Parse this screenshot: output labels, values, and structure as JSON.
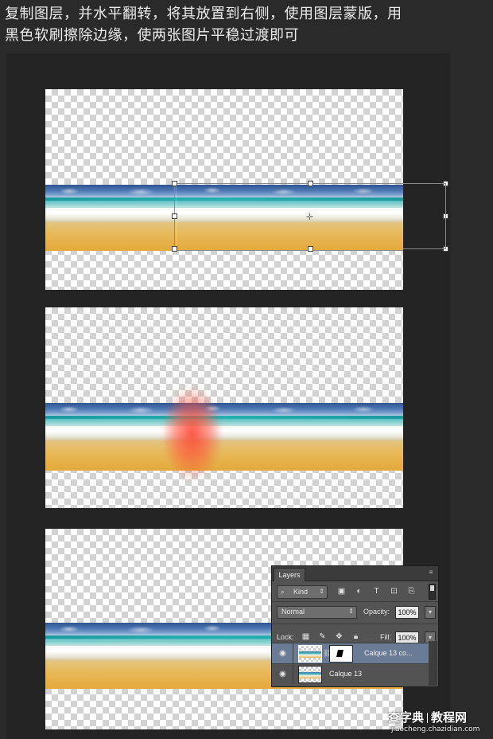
{
  "caption": {
    "line1": "复制图层，并水平翻转，将其放置到右侧，使用图层蒙版，用",
    "line2": "黑色软刷擦除边缘，使两张图片平稳过渡即可"
  },
  "layers_panel": {
    "tab_label": "Layers",
    "menu_icon": "panel-menu-icon",
    "filter": {
      "label": "Kind",
      "icon": "search-icon"
    },
    "filter_icons": [
      "image-filter-icon",
      "adjustment-filter-icon",
      "type-filter-icon",
      "shape-filter-icon",
      "smart-object-filter-icon"
    ],
    "blend_mode": "Normal",
    "opacity_label": "Opacity:",
    "opacity_value": "100%",
    "lock_label": "Lock:",
    "lock_icons": [
      "lock-transparent-icon",
      "lock-image-icon",
      "lock-position-icon",
      "lock-all-icon"
    ],
    "fill_label": "Fill:",
    "fill_value": "100%",
    "layers": [
      {
        "name": "Calque 13 co...",
        "selected": true,
        "has_mask": true
      },
      {
        "name": "Calque 13",
        "selected": false,
        "has_mask": false
      }
    ]
  },
  "watermark": {
    "line1_a": "查字典",
    "line1_b": "教程网",
    "line2": "jiaocheng.chazidian.com"
  },
  "colors": {
    "background": "#2a2a2a",
    "panel": "#535353",
    "selected_layer": "#6a7b96",
    "brush_red": "#ff3c28"
  }
}
